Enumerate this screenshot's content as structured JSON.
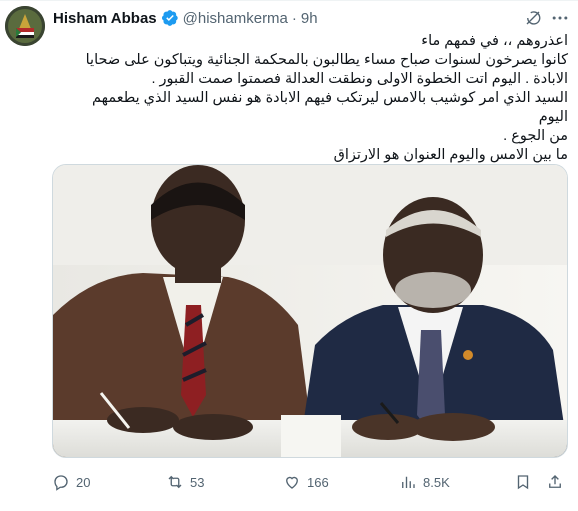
{
  "author": {
    "name": "Hisham Abbas",
    "handle": "@hishamkerma",
    "separator": "·",
    "time": "9h"
  },
  "tweet_lines": [
    "اعذروهم ،، في فمهم ماء",
    "كانوا يصرخون لسنوات صباح مساء يطالبون بالمحكمة الجنائية ويتباكون على ضحايا",
    "الابادة . اليوم اتت الخطوة الاولى ونطقت العدالة فصمتوا صمت القبور .",
    "السيد الذي امر كوشيب بالامس ليرتكب فيهم الابادة هو نفس السيد الذي يطعمهم اليوم",
    "من الجوع .",
    "ما بين الامس واليوم العنوان هو الارتزاق"
  ],
  "actions": {
    "replies": "20",
    "reposts": "53",
    "likes": "166",
    "views": "8.5K"
  },
  "icons": {
    "verified": "verified-badge-icon",
    "grok": "grok-icon",
    "more": "more-icon",
    "reply": "reply-icon",
    "repost": "repost-icon",
    "like": "heart-icon",
    "views": "views-icon",
    "bookmark": "bookmark-icon",
    "share": "share-icon"
  },
  "colors": {
    "verified": "#1d9bf0",
    "secondary_text": "#536471",
    "primary_text": "#0f1419"
  }
}
